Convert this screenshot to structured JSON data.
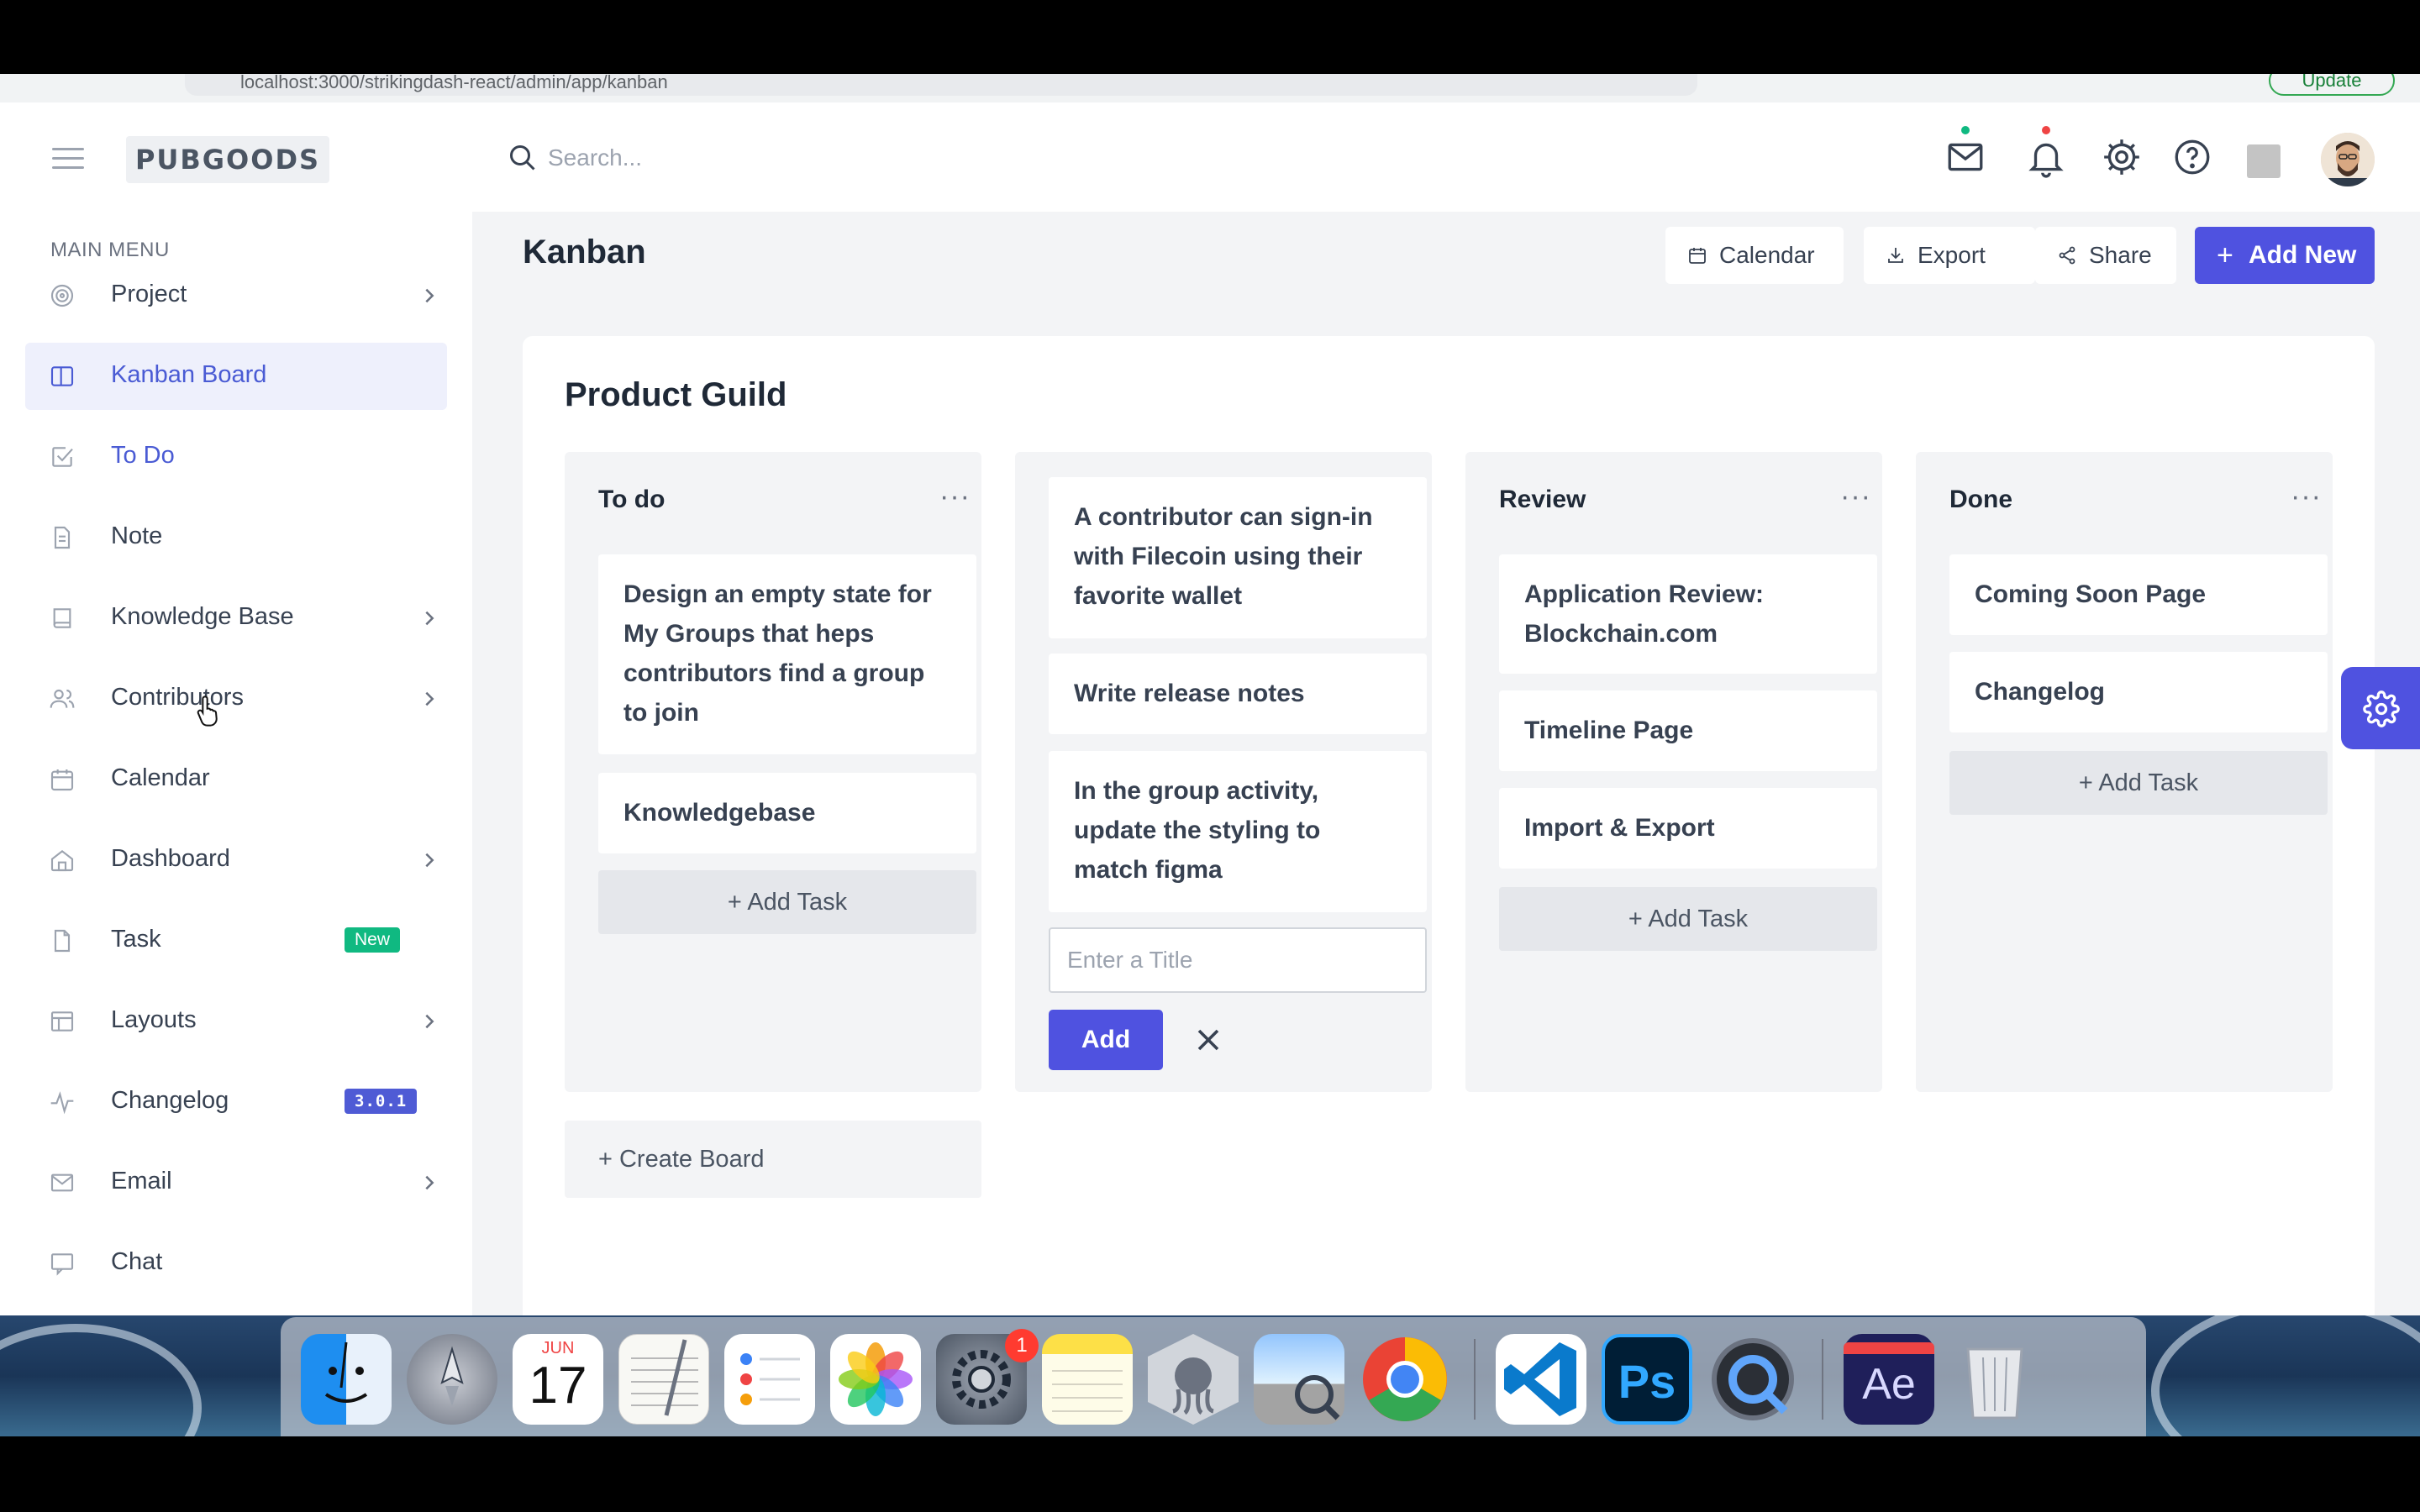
{
  "browser": {
    "url": "localhost:3000/strikingdash-react/admin/app/kanban",
    "update_label": "Update"
  },
  "header": {
    "logo_text": "PUBGOODS",
    "search_placeholder": "Search...",
    "icons": [
      "mail-icon",
      "bell-icon",
      "gear-icon",
      "help-icon"
    ]
  },
  "sidebar": {
    "heading": "MAIN MENU",
    "items": [
      {
        "label": "Project",
        "icon": "target-icon",
        "has_children": true
      },
      {
        "label": "Kanban Board",
        "icon": "columns-icon",
        "active": true
      },
      {
        "label": "To Do",
        "icon": "checkbox-icon"
      },
      {
        "label": "Note",
        "icon": "file-text-icon"
      },
      {
        "label": "Knowledge Base",
        "icon": "book-icon",
        "has_children": true
      },
      {
        "label": "Contributors",
        "icon": "users-icon",
        "has_children": true
      },
      {
        "label": "Calendar",
        "icon": "calendar-icon"
      },
      {
        "label": "Dashboard",
        "icon": "home-icon",
        "has_children": true
      },
      {
        "label": "Task",
        "icon": "file-icon",
        "badge": "New"
      },
      {
        "label": "Layouts",
        "icon": "layout-icon",
        "has_children": true
      },
      {
        "label": "Changelog",
        "icon": "activity-icon",
        "badge": "3.0.1"
      },
      {
        "label": "Email",
        "icon": "mail-icon",
        "has_children": true
      },
      {
        "label": "Chat",
        "icon": "chat-icon"
      }
    ]
  },
  "page": {
    "title": "Kanban",
    "buttons": {
      "calendar": "Calendar",
      "export": "Export",
      "share": "Share",
      "add_new": "Add New"
    }
  },
  "board": {
    "title": "Product Guild",
    "columns": [
      {
        "title": "To do",
        "tasks": [
          "Design an empty state for My Groups that heps contributors find a group to join",
          "Knowledgebase"
        ],
        "add_task": "+ Add Task"
      },
      {
        "title": "",
        "tasks": [
          "A contributor can sign-in with Filecoin using their favorite wallet",
          "Write release notes",
          "In the group activity, update the styling to match figma"
        ],
        "input_placeholder": "Enter a Title",
        "add_button": "Add"
      },
      {
        "title": "Review",
        "tasks": [
          "Application Review: Blockchain.com",
          "Timeline Page",
          "Import & Export"
        ],
        "add_task": "+ Add Task"
      },
      {
        "title": "Done",
        "tasks": [
          "Coming Soon Page",
          "Changelog"
        ],
        "add_task": "+ Add Task"
      }
    ],
    "create_board": "+ Create Board"
  },
  "dock": {
    "calendar_month": "JUN",
    "calendar_day": "17",
    "settings_badge": "1",
    "ps_label": "Ps",
    "ae_label": "Ae"
  },
  "colors": {
    "accent": "#4f52e0",
    "active_bg": "#eef0fc",
    "active_text": "#4a5bd4",
    "badge_new": "#10b981",
    "badge_version": "#4f5bd5"
  }
}
